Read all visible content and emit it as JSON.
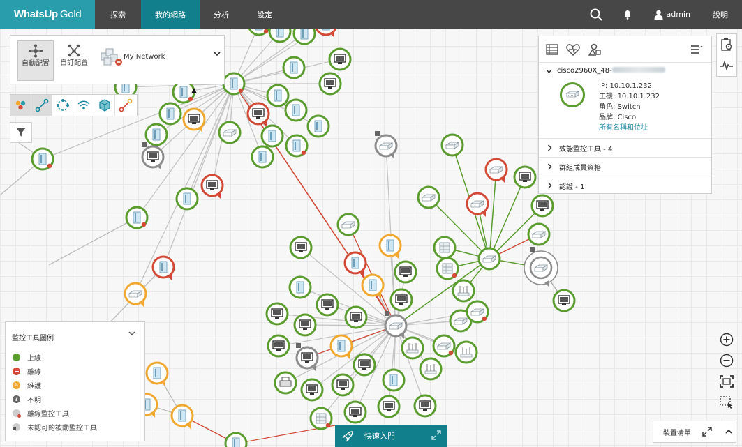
{
  "app": {
    "logo_main": "WhatsUp",
    "logo_sub": "Gold"
  },
  "nav": {
    "tabs": [
      {
        "label": "探索"
      },
      {
        "label": "我的網路"
      },
      {
        "label": "分析"
      },
      {
        "label": "設定"
      }
    ],
    "active_index": 1,
    "user": "admin",
    "help": "說明"
  },
  "layout_panel": {
    "auto_layout": "自動配置",
    "custom_layout": "自訂配置",
    "network": "My Network"
  },
  "device_panel": {
    "name_prefix": "cisco2960X_48-",
    "ip_label": "IP:",
    "ip": "10.10.1.232",
    "host_label": "主機:",
    "host": "10.10.1.232",
    "role_label": "角色:",
    "role": "Switch",
    "brand_label": "品牌:",
    "brand": "Cisco",
    "all_names_link": "所有名稱和位址",
    "sections": [
      {
        "label": "效能監控工具 - 4"
      },
      {
        "label": "群組成員資格"
      },
      {
        "label": "認證 - 1"
      }
    ]
  },
  "legend": {
    "title": "監控工具圖例",
    "items": [
      {
        "label": "上線",
        "color": "#5a9c2e"
      },
      {
        "label": "離線",
        "color": "#d24a36"
      },
      {
        "label": "維護",
        "color": "#f0a830"
      },
      {
        "label": "不明",
        "color": "#666666"
      },
      {
        "label": "離線監控工具",
        "color": "#cccccc"
      },
      {
        "label": "未認可的被動監控工具",
        "color": "#cccccc"
      }
    ]
  },
  "quick_start": "快速入門",
  "device_list": "裝置清單",
  "colors": {
    "up": "#5a9c2e",
    "down": "#d24a36",
    "maint": "#f0a830",
    "unknown": "#8c8c8c",
    "accent": "#127f8c",
    "logo_bg": "#2a9dad"
  }
}
